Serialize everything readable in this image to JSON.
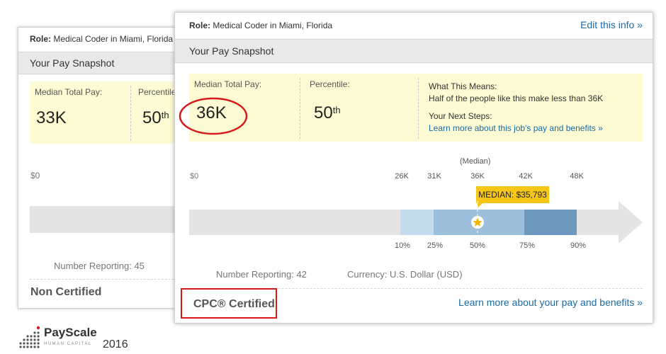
{
  "back_card": {
    "role_label": "Role:",
    "role_value": "Medical Coder in Miami, Florida",
    "snapshot_title": "Your Pay Snapshot",
    "median_label": "Median Total Pay:",
    "median_value": "33K",
    "percentile_label": "Percentile",
    "percentile_value": "50",
    "percentile_suffix": "th",
    "axis_start": "$0",
    "number_reporting": "Number Reporting: 45",
    "certification": "Non Certified"
  },
  "front_card": {
    "role_label": "Role:",
    "role_value": "Medical Coder in Miami, Florida",
    "edit_link": "Edit this info »",
    "snapshot_title": "Your Pay Snapshot",
    "median_label": "Median Total Pay:",
    "median_value": "36K",
    "percentile_label": "Percentile:",
    "percentile_value": "50",
    "percentile_suffix": "th",
    "what_means_title": "What This Means:",
    "what_means_text": "Half of the people like this make less than 36K",
    "next_steps_title": "Your Next Steps:",
    "next_steps_link": "Learn more about this job's pay and benefits »",
    "axis_start": "$0",
    "median_caption": "(Median)",
    "top_ticks": [
      "26K",
      "31K",
      "36K",
      "42K",
      "48K"
    ],
    "median_tooltip": "MEDIAN: $35,793",
    "bottom_ticks": [
      "10%",
      "25%",
      "50%",
      "75%",
      "90%"
    ],
    "number_reporting": "Number Reporting: 42",
    "currency": "Currency: U.S. Dollar (USD)",
    "certification": "CPC® Certified",
    "benefits_link": "Learn more about your pay and benefits »"
  },
  "logo": {
    "brand": "PayScale",
    "tagline": "HUMAN CAPITAL",
    "year": "2016"
  },
  "colors": {
    "highlight_red": "#d7191c",
    "link_blue": "#1a6aa5",
    "tooltip_yellow": "#f5c518",
    "band_light": "#c5dcec",
    "band_mid": "#9cbfdb",
    "band_dark": "#6f98bf",
    "arrow_grey": "#e4e4e4",
    "panel_yellow": "#fdfbd3"
  }
}
